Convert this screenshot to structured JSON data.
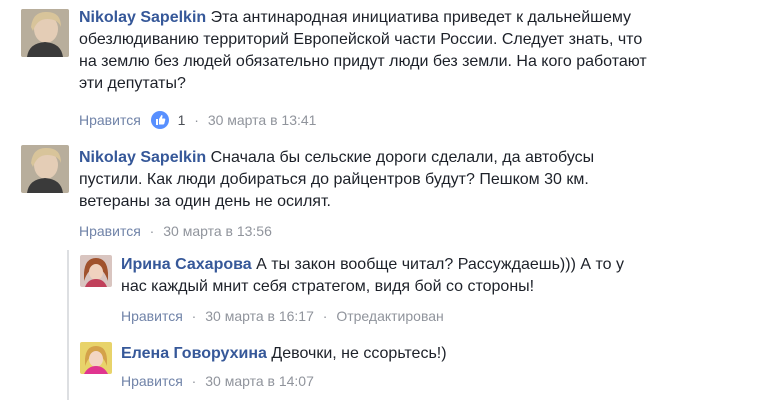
{
  "comments": [
    {
      "author": "Nikolay Sapelkin",
      "text_lines": [
        "Эта антинародная инициатива приведет к дальнейшему",
        "обезлюдиванию территорий Европейской части России. Следует знать, что",
        "на землю без людей обязательно придут люди без земли. На кого работают",
        "эти депутаты?"
      ],
      "like_label": "Нравится",
      "like_count": "1",
      "time": "30 марта в 13:41"
    },
    {
      "author": "Nikolay Sapelkin",
      "text_lines": [
        "Сначала бы сельские дороги сделали, да автобусы",
        "пустили. Как люди добираться до райцентров будут? Пешком 30 км.",
        "ветераны за один день не осилят."
      ],
      "like_label": "Нравится",
      "time": "30 марта в 13:56"
    }
  ],
  "replies": [
    {
      "author": "Ирина Сахарова",
      "text_lines": [
        "А ты закон вообще читал? Рассуждаешь))) А то у",
        "нас каждый мнит себя стратегом, видя бой со стороны!"
      ],
      "like_label": "Нравится",
      "time": "30 марта в 16:17",
      "edited": "Отредактирован"
    },
    {
      "author": "Елена Говорухина",
      "text_lines": [
        "Девочки, не ссорьтесь!)"
      ],
      "like_label": "Нравится",
      "time": "30 марта в 14:07"
    }
  ],
  "separator": "·",
  "colors": {
    "author": "#365899",
    "meta": "#90949c",
    "like_icon": "#5890ff"
  },
  "icons": {
    "like": "thumbs-up-icon"
  }
}
